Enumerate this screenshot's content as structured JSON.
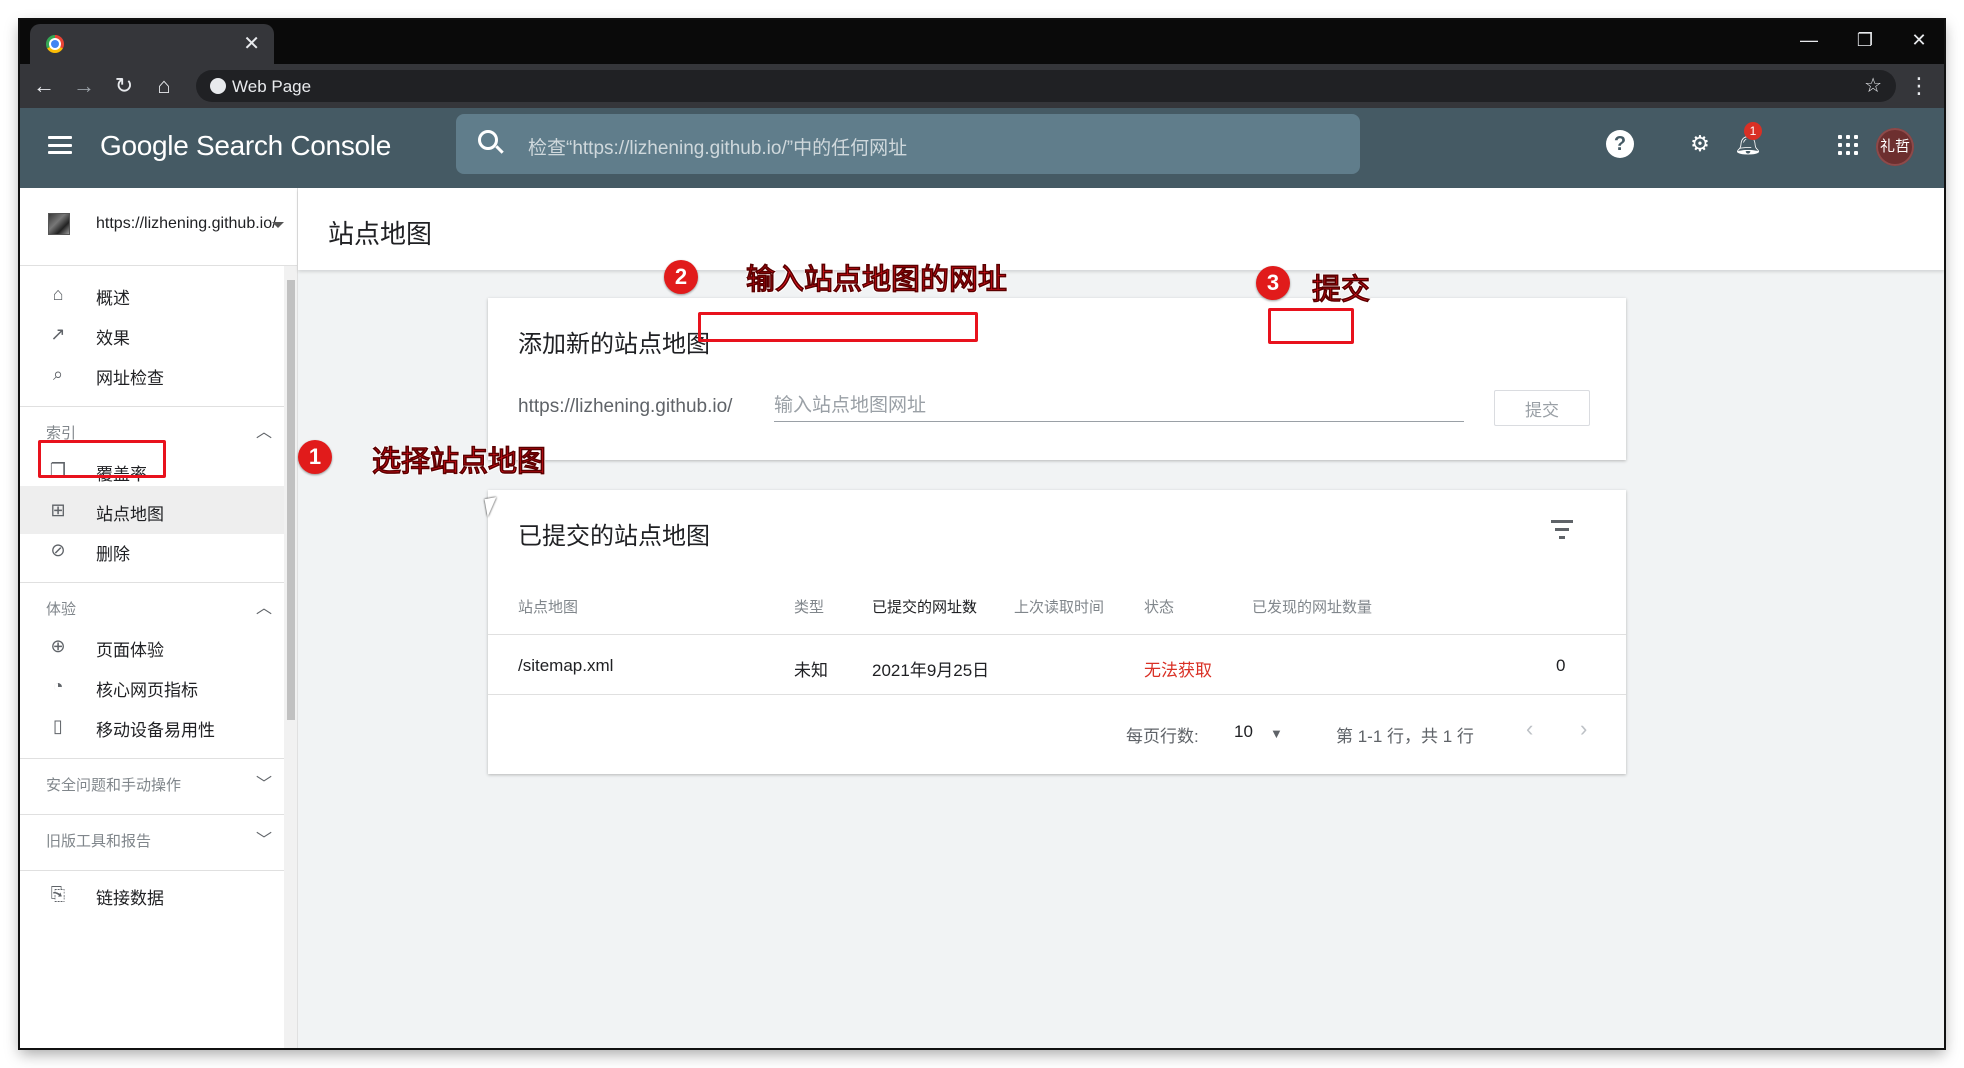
{
  "browser": {
    "tab_close": "✕",
    "address": "Web Page",
    "window_controls": [
      "—",
      "❐",
      "✕"
    ]
  },
  "header": {
    "logo": "Google Search Console",
    "search_placeholder": "检查“https://lizhening.github.io/”中的任何网址",
    "notification_count": "1",
    "avatar_text": "礼哲"
  },
  "sidebar": {
    "property": "https://lizhening.github.io/",
    "items_top": [
      {
        "icon": "home-icon",
        "label": "概述"
      },
      {
        "icon": "trending-up-icon",
        "label": "效果"
      },
      {
        "icon": "search-icon",
        "label": "网址检查"
      }
    ],
    "section_index": "索引",
    "items_index": [
      {
        "icon": "copy-icon",
        "label": "覆盖率"
      },
      {
        "icon": "sitemap-icon",
        "label": "站点地图"
      },
      {
        "icon": "eye-off-icon",
        "label": "删除"
      }
    ],
    "section_experience": "体验",
    "items_experience": [
      {
        "icon": "plus-circle-icon",
        "label": "页面体验"
      },
      {
        "icon": "gauge-icon",
        "label": "核心网页指标"
      },
      {
        "icon": "phone-icon",
        "label": "移动设备易用性"
      }
    ],
    "section_security": "安全问题和手动操作",
    "section_legacy": "旧版工具和报告",
    "partial_item": "链接数据"
  },
  "main": {
    "page_title": "站点地图",
    "add_card": {
      "title": "添加新的站点地图",
      "prefix": "https://lizhening.github.io/",
      "input_placeholder": "输入站点地图网址",
      "input_value": "",
      "submit_label": "提交"
    },
    "list_card": {
      "title": "已提交的站点地图",
      "columns": [
        "站点地图",
        "类型",
        "已提交的网址数",
        "上次读取时间",
        "状态",
        "已发现的网址数量"
      ],
      "sort_arrow": "↓",
      "rows": [
        {
          "sitemap": "/sitemap.xml",
          "type": "未知",
          "submitted": "2021年9月25日",
          "last_read": "",
          "status": "无法获取",
          "discovered": "0"
        }
      ],
      "rows_per_page_label": "每页行数:",
      "rows_per_page": "10",
      "range_text": "第 1-1 行，共 1 行"
    }
  },
  "annotations": {
    "step1_num": "1",
    "step1_text": "选择站点地图",
    "step2_num": "2",
    "step2_text": "输入站点地图的网址",
    "step3_num": "3",
    "step3_text": "提交",
    "color": "#e8121d"
  },
  "colors": {
    "header_bg": "#455a64",
    "search_bg": "#607d8b",
    "error": "#d93025"
  }
}
